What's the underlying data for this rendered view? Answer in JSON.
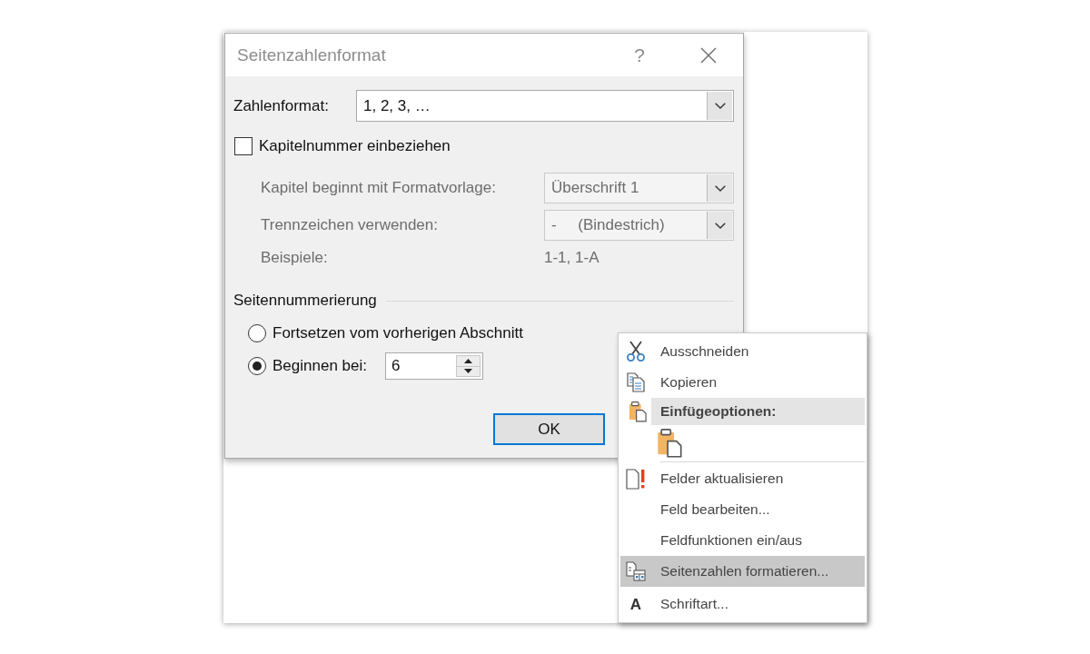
{
  "dialog": {
    "title": "Seitenzahlenformat",
    "help_button": "?",
    "number_format": {
      "label": "Zahlenformat:",
      "value": "1, 2, 3, …"
    },
    "include_chapter": {
      "label": "Kapitelnummer einbeziehen",
      "checked": false
    },
    "chapter_options": [
      {
        "kind": "dropdown",
        "label": "Kapitel beginnt mit Formatvorlage:",
        "value": "Überschrift 1",
        "disabled": true
      },
      {
        "kind": "dropdown",
        "label": "Trennzeichen verwenden:",
        "value": "-     (Bindestrich)",
        "disabled": true
      },
      {
        "kind": "text",
        "label": "Beispiele:",
        "value": "1-1, 1-A",
        "disabled": true
      }
    ],
    "page_numbering": {
      "heading": "Seitennummerierung",
      "options": [
        {
          "kind": "radio",
          "label": "Fortsetzen vom vorherigen Abschnitt",
          "selected": false
        },
        {
          "kind": "radio_spin",
          "label": "Beginnen bei:",
          "value": "6",
          "selected": true
        }
      ]
    },
    "buttons": [
      {
        "label": "OK",
        "default": true
      }
    ]
  },
  "context_menu": {
    "items": [
      {
        "kind": "command",
        "label": "Ausschneiden",
        "selected": false
      },
      {
        "kind": "command",
        "label": "Kopieren",
        "selected": false
      },
      {
        "kind": "heading",
        "label": "Einfügeoptionen:"
      },
      {
        "kind": "paste_options"
      },
      {
        "kind": "separator"
      },
      {
        "kind": "command",
        "label": "Felder aktualisieren",
        "selected": false
      },
      {
        "kind": "command",
        "label": "Feld bearbeiten...",
        "selected": false
      },
      {
        "kind": "command",
        "label": "Feldfunktionen ein/aus",
        "selected": false
      },
      {
        "kind": "command",
        "label": "Seitenzahlen formatieren...",
        "selected": true
      },
      {
        "kind": "command",
        "label": "Schriftart...",
        "glyph": "A",
        "selected": false
      }
    ]
  }
}
